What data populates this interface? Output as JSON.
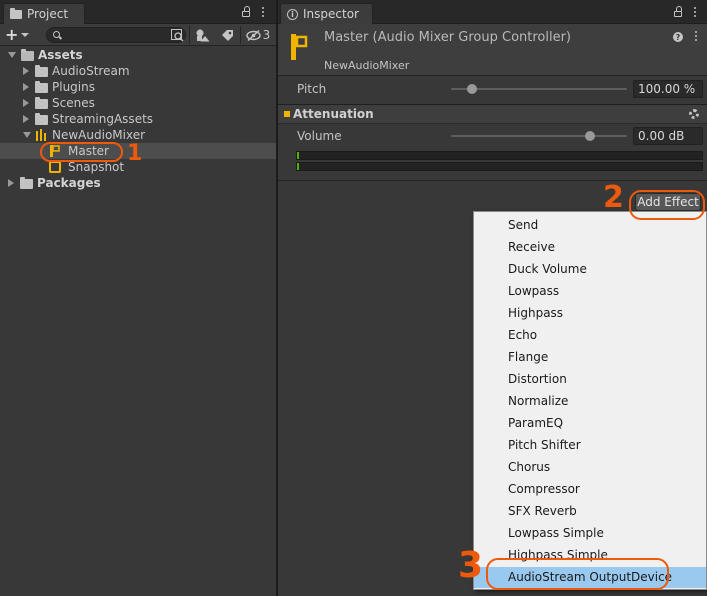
{
  "project": {
    "tab_label": "Project",
    "hidden_count": "3",
    "tree": {
      "assets": "Assets",
      "audio_stream": "AudioStream",
      "plugins": "Plugins",
      "scenes": "Scenes",
      "streaming_assets": "StreamingAssets",
      "new_audio_mixer": "NewAudioMixer",
      "master": "Master",
      "snapshot": "Snapshot",
      "packages": "Packages"
    }
  },
  "inspector": {
    "tab_label": "Inspector",
    "title": "Master (Audio Mixer Group Controller)",
    "subtitle": "NewAudioMixer",
    "pitch_label": "Pitch",
    "pitch_value": "100.00 %",
    "pitch_level": 0.12,
    "attenuation_title": "Attenuation",
    "volume_label": "Volume",
    "volume_value": "0.00 dB",
    "volume_level": 0.79,
    "add_effect_label": "Add Effect"
  },
  "effects_menu": {
    "items": [
      "Send",
      "Receive",
      "Duck Volume",
      "Lowpass",
      "Highpass",
      "Echo",
      "Flange",
      "Distortion",
      "Normalize",
      "ParamEQ",
      "Pitch Shifter",
      "Chorus",
      "Compressor",
      "SFX Reverb",
      "Lowpass Simple",
      "Highpass Simple",
      "AudioStream OutputDevice"
    ],
    "highlighted": "AudioStream OutputDevice"
  },
  "annotations": {
    "step1": "1",
    "step2": "2",
    "step3": "3"
  },
  "colors": {
    "accent_yellow": "#f0b400",
    "annotation_orange": "#ee5a0b",
    "menu_highlight": "#99c9ef"
  }
}
